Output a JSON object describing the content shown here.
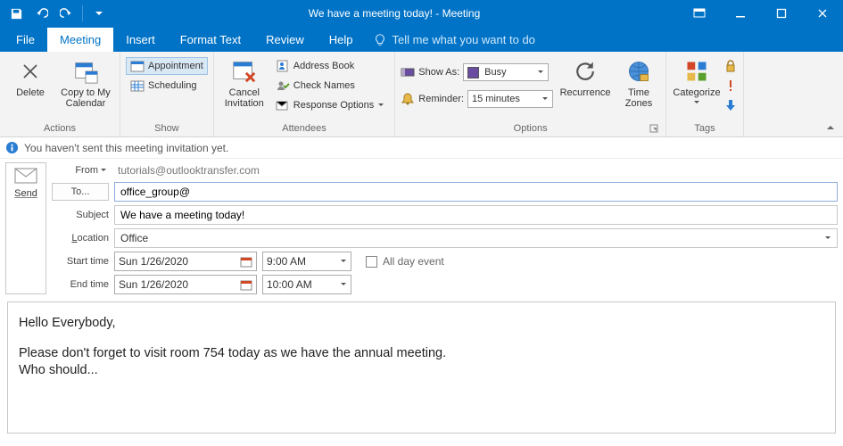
{
  "window": {
    "title": "We have a meeting today!  -  Meeting"
  },
  "tabs": {
    "file": "File",
    "meeting": "Meeting",
    "insert": "Insert",
    "format_text": "Format Text",
    "review": "Review",
    "help": "Help",
    "tell_me": "Tell me what you want to do"
  },
  "ribbon": {
    "actions": {
      "label": "Actions",
      "delete": "Delete",
      "copy_to_my_calendar": "Copy to My\nCalendar"
    },
    "show": {
      "label": "Show",
      "appointment": "Appointment",
      "scheduling": "Scheduling"
    },
    "attendees": {
      "label": "Attendees",
      "cancel_invitation": "Cancel\nInvitation",
      "address_book": "Address Book",
      "check_names": "Check Names",
      "response_options": "Response Options"
    },
    "options": {
      "label": "Options",
      "show_as_label": "Show As:",
      "show_as_value": "Busy",
      "reminder_label": "Reminder:",
      "reminder_value": "15 minutes",
      "recurrence": "Recurrence",
      "time_zones": "Time\nZones"
    },
    "tags": {
      "label": "Tags",
      "categorize": "Categorize"
    }
  },
  "info_bar": "You haven't sent this meeting invitation yet.",
  "form": {
    "send": "Send",
    "from_label": "From",
    "from_value": "tutorials@outlooktransfer.com",
    "to_label": "To...",
    "to_value": "office_group@",
    "subject_label": "Subject",
    "subject_value": "We have a meeting today!",
    "location_label": "Location",
    "location_value": "Office",
    "start_label": "Start time",
    "start_date": "Sun 1/26/2020",
    "start_time": "9:00 AM",
    "end_label": "End time",
    "end_date": "Sun 1/26/2020",
    "end_time": "10:00 AM",
    "all_day": "All day event"
  },
  "body": {
    "line1": "Hello Everybody,",
    "line2": "Please don't forget to visit room 754 today as we have the annual meeting.",
    "line3": "Who should..."
  },
  "colors": {
    "accent": "#0173c7"
  }
}
